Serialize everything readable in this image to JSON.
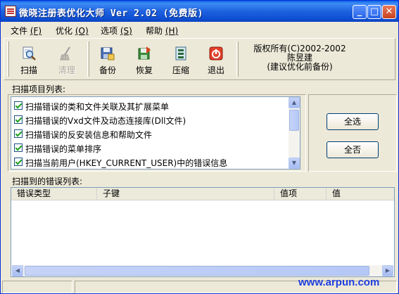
{
  "window": {
    "title": "微晓注册表优化大师 Ver 2.02 (免费版)",
    "controls": {
      "minimize": "_",
      "maximize": "□",
      "close": "✕"
    }
  },
  "menu": [
    {
      "label": "文件",
      "mnemonic": "(F)"
    },
    {
      "label": "优化",
      "mnemonic": "(O)"
    },
    {
      "label": "选项",
      "mnemonic": "(S)"
    },
    {
      "label": "帮助",
      "mnemonic": "(H)"
    }
  ],
  "toolbar": {
    "buttons": [
      {
        "label": "扫描",
        "icon": "scan-icon",
        "enabled": true
      },
      {
        "label": "清理",
        "icon": "clean-icon",
        "enabled": false
      },
      {
        "label": "备份",
        "icon": "backup-icon",
        "enabled": true
      },
      {
        "label": "恢复",
        "icon": "restore-icon",
        "enabled": true
      },
      {
        "label": "压缩",
        "icon": "compress-icon",
        "enabled": true
      },
      {
        "label": "退出",
        "icon": "exit-icon",
        "enabled": true
      }
    ],
    "copyright": {
      "line1": "版权所有(C)2002-2002",
      "line2": "陈昱建",
      "line3": "(建议优化前备份)"
    }
  },
  "scan_section": {
    "label": "扫描项目列表:",
    "items": [
      {
        "text": "扫描错误的类和文件关联及其扩展菜单",
        "checked": true
      },
      {
        "text": "扫描错误的Vxd文件及动态连接库(Dll文件)",
        "checked": true
      },
      {
        "text": "扫描错误的反安装信息和帮助文件",
        "checked": true
      },
      {
        "text": "扫描错误的菜单排序",
        "checked": true
      },
      {
        "text": "扫描当前用户(HKEY_CURRENT_USER)中的错误信息",
        "checked": true
      }
    ],
    "select_all_label": "全选",
    "select_none_label": "全否"
  },
  "error_section": {
    "label": "扫描到的错误列表:",
    "columns": [
      "错误类型",
      "子键",
      "值项",
      "值"
    ],
    "rows": []
  },
  "watermark": "www.arpun.com",
  "colors": {
    "titlebar": "#0a5fe6",
    "window_bg": "#ece9d8",
    "check": "#21a121",
    "watermark": "#1f3ee0"
  }
}
